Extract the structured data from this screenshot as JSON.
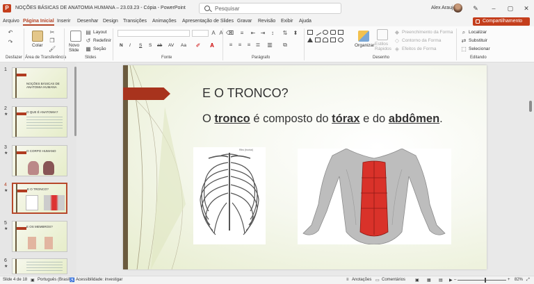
{
  "window": {
    "title": "NOÇÕES BÁSICAS DE ANATOMIA HUMANA – 23.03.23 - Cópia  -  PowerPoint",
    "search_placeholder": "Pesquisar",
    "user": "Alex Araujo"
  },
  "menu": {
    "items": [
      "Arquivo",
      "Página Inicial",
      "Inserir",
      "Desenhar",
      "Design",
      "Transições",
      "Animações",
      "Apresentação de Slides",
      "Gravar",
      "Revisão",
      "Exibir",
      "Ajuda"
    ],
    "active": "Página Inicial",
    "share_label": "Compartilhamento"
  },
  "ribbon": {
    "groups": {
      "undo": "Desfazer",
      "clipboard": "Área de Transferência",
      "slides": "Slides",
      "font": "Fonte",
      "paragraph": "Parágrafo",
      "drawing": "Desenho",
      "editing": "Editando"
    },
    "clipboard_paste": "Colar",
    "slides_new": "Novo Slide",
    "slides_layout": "Layout",
    "slides_reset": "Redefinir",
    "slides_section": "Seção",
    "font_buttons": [
      "N",
      "I",
      "S",
      "S",
      "ab",
      "AV",
      "Aa"
    ],
    "drawing_arrange": "Organizar",
    "drawing_quick_styles": "Estilos Rápidos",
    "shape_fill": "Preenchimento da Forma",
    "shape_outline": "Contorno da Forma",
    "shape_effects": "Efeitos de Forma",
    "find": "Localizar",
    "replace": "Substituir",
    "select": "Selecionar"
  },
  "thumbnails": [
    {
      "num": "1",
      "title": "NOÇÕES BÁSICAS DE ANATOMIA HUMANA"
    },
    {
      "num": "2",
      "title": "O QUE É ANATOMIA?"
    },
    {
      "num": "3",
      "title": "O CORPO HUMANO"
    },
    {
      "num": "4",
      "title": "E O TRONCO?"
    },
    {
      "num": "5",
      "title": "E OS MEMBROS?"
    },
    {
      "num": "6",
      "title": ""
    }
  ],
  "slide": {
    "title": "E O TRONCO?",
    "body_prefix": "O ",
    "kw1": "tronco",
    "body_mid": " é composto do ",
    "kw2": "tórax",
    "body_and": " e do ",
    "kw3": "abdômen",
    "body_end": ".",
    "rib_caption": "Ribs (frontal)"
  },
  "status": {
    "slide_pos": "Slide 4 de 18",
    "language": "Português (Brasil)",
    "accessibility": "Acessibilidade: investigar",
    "notes": "Anotações",
    "comments": "Comentários",
    "zoom": "82%"
  },
  "colors": {
    "accent": "#b7472a",
    "share": "#c43e1c",
    "slide_arrow": "#a8331d"
  }
}
